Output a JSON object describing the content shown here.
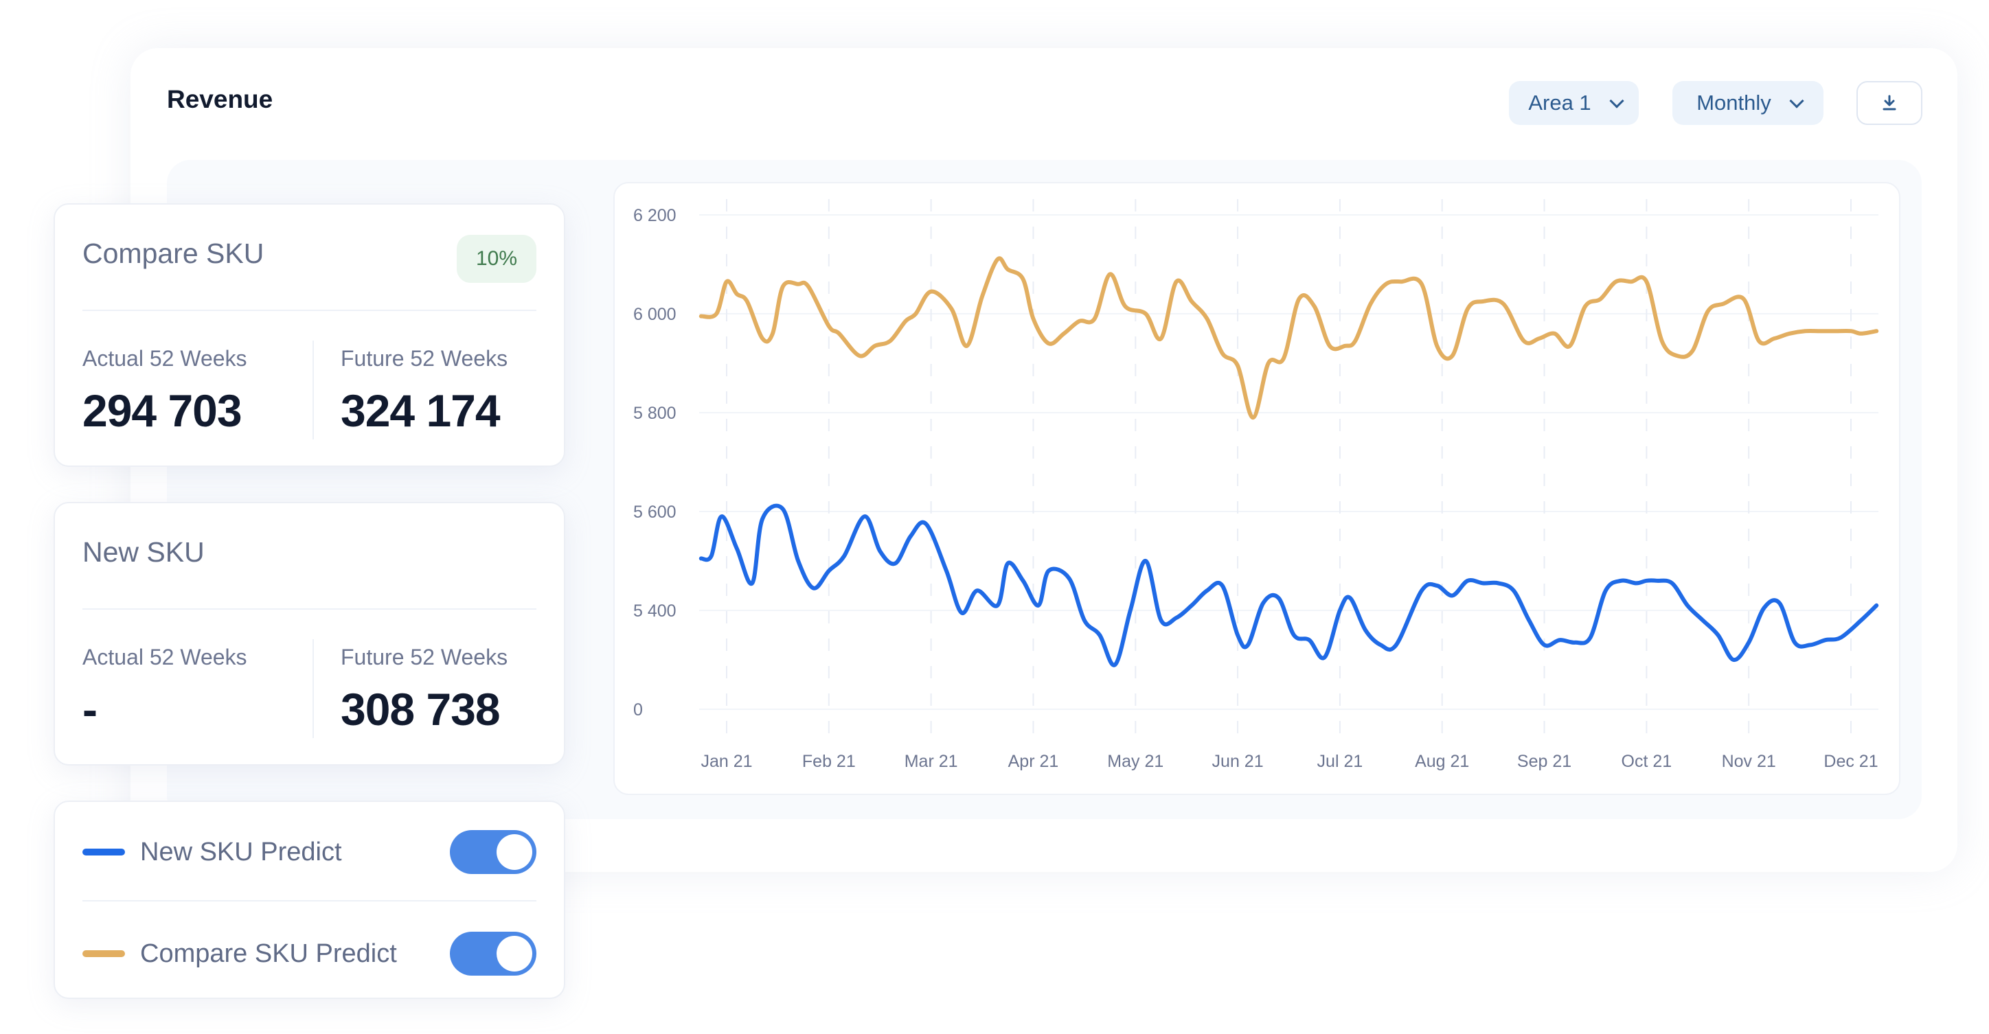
{
  "header": {
    "title": "Revenue",
    "area_dropdown": "Area 1",
    "period_dropdown": "Monthly",
    "download_icon": "download-icon"
  },
  "cards": {
    "compare": {
      "title": "Compare SKU",
      "badge": "10%",
      "actual_label": "Actual 52 Weeks",
      "actual_value": "294 703",
      "future_label": "Future 52 Weeks",
      "future_value": "324 174"
    },
    "new": {
      "title": "New SKU",
      "actual_label": "Actual 52 Weeks",
      "actual_value": "-",
      "future_label": "Future 52 Weeks",
      "future_value": "308 738"
    }
  },
  "legend": [
    {
      "label": "New SKU Predict",
      "color": "#1f6ae6",
      "enabled": true
    },
    {
      "label": "Compare SKU Predict",
      "color": "#e2ae60",
      "enabled": true
    }
  ],
  "colors": {
    "new_sku": "#1f6ae6",
    "compare_sku": "#e2ae60",
    "toggle_on": "#4b88e6",
    "badge_bg": "#ebf6ee",
    "badge_text": "#3f7a4d"
  },
  "chart_data": {
    "type": "line",
    "title": "Revenue",
    "xlabel": "",
    "ylabel": "",
    "y_ticks": [
      "6 200",
      "6 000",
      "5 800",
      "5 600",
      "5 400",
      "0"
    ],
    "y_tick_values": [
      6200,
      6000,
      5800,
      5600,
      5400,
      5200
    ],
    "ylim": [
      5200,
      6200
    ],
    "y_axis_break": "bottom tick labeled 0 (axis break below 5 400)",
    "x_ticks": [
      "Jan 21",
      "Feb 21",
      "Mar 21",
      "Apr 21",
      "May 21",
      "Jun 21",
      "Jul 21",
      "Aug 21",
      "Sep 21",
      "Oct 21",
      "Nov 21",
      "Dec 21"
    ],
    "x_range_months": [
      -0.25,
      11.25
    ],
    "grid": true,
    "legend": "left-panel",
    "series": [
      {
        "name": "Compare SKU Predict",
        "color": "#e2ae60",
        "x": [
          -0.25,
          -0.1,
          0.0,
          0.1,
          0.2,
          0.35,
          0.45,
          0.55,
          0.7,
          0.8,
          1.0,
          1.1,
          1.3,
          1.45,
          1.6,
          1.75,
          1.85,
          2.0,
          2.2,
          2.35,
          2.5,
          2.65,
          2.75,
          2.9,
          3.0,
          3.15,
          3.3,
          3.45,
          3.6,
          3.75,
          3.9,
          4.1,
          4.25,
          4.4,
          4.55,
          4.7,
          4.85,
          5.0,
          5.15,
          5.3,
          5.45,
          5.6,
          5.75,
          5.9,
          6.05,
          6.15,
          6.3,
          6.45,
          6.6,
          6.8,
          6.95,
          7.1,
          7.25,
          7.4,
          7.6,
          7.8,
          7.95,
          8.1,
          8.25,
          8.4,
          8.55,
          8.7,
          8.85,
          9.0,
          9.15,
          9.3,
          9.45,
          9.6,
          9.75,
          9.95,
          10.1,
          10.25,
          10.4,
          10.55,
          10.7,
          10.85,
          11.0,
          11.1,
          11.25
        ],
        "values": [
          5995,
          6000,
          6065,
          6040,
          6025,
          5950,
          5960,
          6055,
          6060,
          6055,
          5975,
          5960,
          5915,
          5935,
          5945,
          5985,
          6000,
          6045,
          6010,
          5935,
          6035,
          6110,
          6090,
          6070,
          5990,
          5940,
          5960,
          5985,
          5990,
          6080,
          6015,
          6000,
          5950,
          6065,
          6025,
          5990,
          5920,
          5895,
          5790,
          5900,
          5910,
          6030,
          6015,
          5935,
          5935,
          5945,
          6020,
          6060,
          6065,
          6060,
          5935,
          5915,
          6010,
          6025,
          6020,
          5945,
          5950,
          5960,
          5935,
          6015,
          6030,
          6065,
          6065,
          6065,
          5945,
          5915,
          5925,
          6005,
          6020,
          6030,
          5945,
          5950,
          5960,
          5965,
          5965,
          5965,
          5965,
          5960,
          5965
        ]
      },
      {
        "name": "New SKU Predict",
        "color": "#1f6ae6",
        "x": [
          -0.25,
          -0.15,
          -0.05,
          0.1,
          0.25,
          0.35,
          0.55,
          0.7,
          0.85,
          1.0,
          1.15,
          1.35,
          1.5,
          1.65,
          1.8,
          1.95,
          2.15,
          2.3,
          2.45,
          2.65,
          2.75,
          2.9,
          3.05,
          3.15,
          3.35,
          3.5,
          3.65,
          3.8,
          3.95,
          4.1,
          4.25,
          4.4,
          4.55,
          4.7,
          4.85,
          5.0,
          5.1,
          5.25,
          5.4,
          5.55,
          5.7,
          5.85,
          6.0,
          6.1,
          6.25,
          6.4,
          6.55,
          6.8,
          6.95,
          7.1,
          7.25,
          7.4,
          7.55,
          7.7,
          7.85,
          8.0,
          8.15,
          8.3,
          8.45,
          8.6,
          8.75,
          8.9,
          9.0,
          9.1,
          9.25,
          9.4,
          9.55,
          9.7,
          9.85,
          10.0,
          10.15,
          10.3,
          10.45,
          10.6,
          10.75,
          10.9,
          11.1,
          11.25
        ],
        "values": [
          5505,
          5510,
          5590,
          5525,
          5455,
          5585,
          5605,
          5500,
          5445,
          5480,
          5510,
          5590,
          5520,
          5495,
          5550,
          5575,
          5480,
          5395,
          5440,
          5410,
          5495,
          5460,
          5410,
          5480,
          5465,
          5380,
          5350,
          5290,
          5400,
          5500,
          5380,
          5385,
          5410,
          5440,
          5450,
          5350,
          5330,
          5415,
          5425,
          5350,
          5340,
          5305,
          5400,
          5425,
          5360,
          5330,
          5330,
          5440,
          5450,
          5430,
          5460,
          5455,
          5455,
          5440,
          5380,
          5330,
          5340,
          5335,
          5345,
          5440,
          5460,
          5455,
          5460,
          5460,
          5455,
          5410,
          5380,
          5350,
          5300,
          5335,
          5405,
          5415,
          5335,
          5330,
          5340,
          5345,
          5380,
          5410
        ]
      }
    ]
  }
}
